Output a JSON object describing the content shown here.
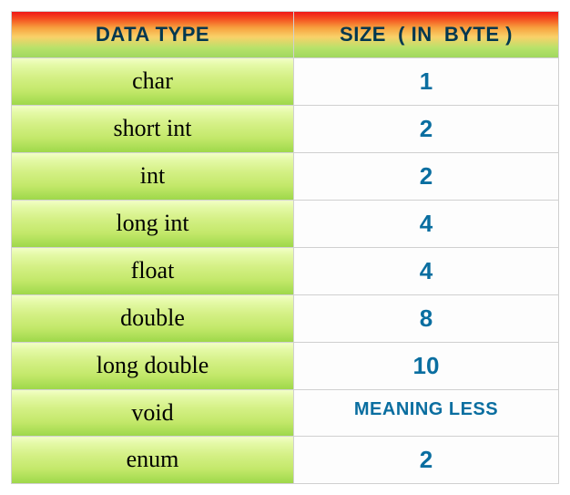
{
  "chart_data": {
    "type": "table",
    "title": "",
    "columns": [
      "DATA TYPE",
      "SIZE  ( IN  BYTE )"
    ],
    "rows": [
      {
        "type": "char",
        "size": "1"
      },
      {
        "type": "short int",
        "size": "2"
      },
      {
        "type": "int",
        "size": "2"
      },
      {
        "type": "long int",
        "size": "4"
      },
      {
        "type": "float",
        "size": "4"
      },
      {
        "type": "double",
        "size": "8"
      },
      {
        "type": "long double",
        "size": "10"
      },
      {
        "type": "void",
        "size": "MEANING LESS"
      },
      {
        "type": "enum",
        "size": "2"
      }
    ]
  }
}
